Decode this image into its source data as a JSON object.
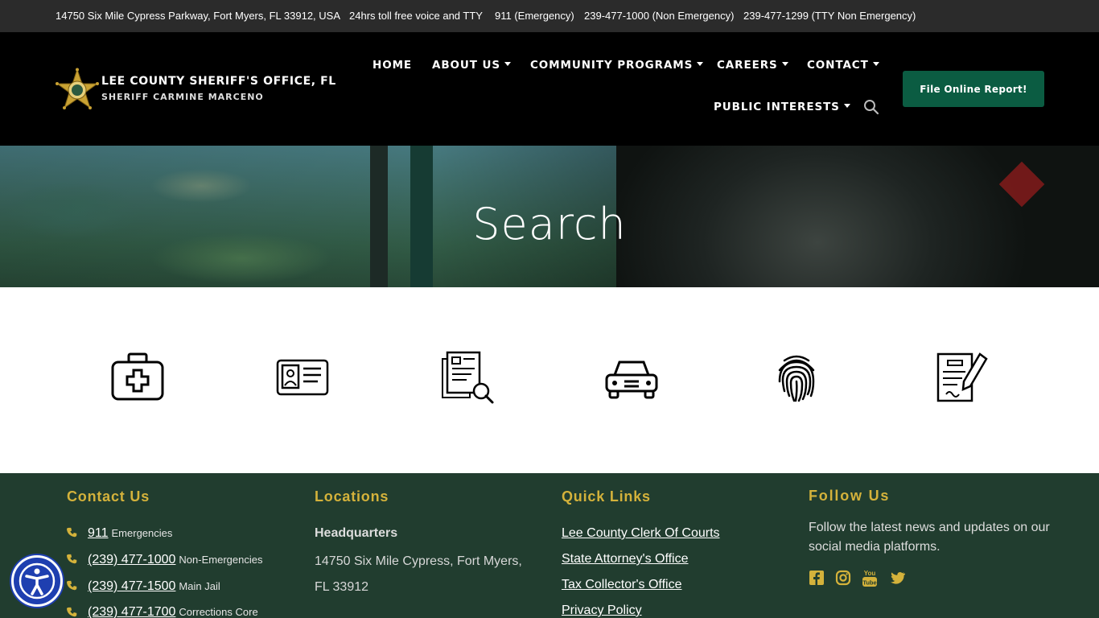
{
  "topbar": {
    "address": "14750 Six Mile Cypress Parkway, Fort Myers, FL 33912, USA",
    "tty": "24hrs toll free voice and TTY",
    "emergency": "911 (Emergency)",
    "non_emergency": "239-477-1000 (Non Emergency)",
    "tty_non_emergency": "239-477-1299 (TTY Non Emergency)"
  },
  "header": {
    "title": "LEE COUNTY SHERIFF'S OFFICE, FL",
    "subtitle": "SHERIFF CARMINE MARCENO",
    "nav": {
      "home": "HOME",
      "about": "ABOUT US",
      "community": "COMMUNITY PROGRAMS",
      "careers": "CAREERS",
      "contact": "CONTACT",
      "public": "PUBLIC INTERESTS"
    },
    "report_button": "File Online Report!"
  },
  "hero": {
    "title": "Search"
  },
  "services": [
    {
      "icon": "medical-kit-icon"
    },
    {
      "icon": "id-card-icon"
    },
    {
      "icon": "document-search-icon"
    },
    {
      "icon": "car-icon"
    },
    {
      "icon": "fingerprint-icon"
    },
    {
      "icon": "report-form-icon"
    }
  ],
  "footer": {
    "contact": {
      "heading": "Contact Us",
      "items": [
        {
          "number": "911",
          "note": "Emergencies"
        },
        {
          "number": "(239) 477-1000",
          "note": "Non-Emergencies"
        },
        {
          "number": "(239) 477-1500",
          "note": "Main Jail"
        },
        {
          "number": "(239) 477-1700",
          "note": "Corrections Core"
        }
      ]
    },
    "locations": {
      "heading": "Locations",
      "hq": "Headquarters",
      "address": "14750 Six Mile Cypress, Fort Myers, FL 33912"
    },
    "quick_links": {
      "heading": "Quick Links",
      "items": [
        "Lee County Clerk Of Courts",
        "State Attorney's Office",
        "Tax Collector's Office",
        "Privacy Policy"
      ]
    },
    "follow": {
      "heading": "Follow Us",
      "text": "Follow the latest news and updates on our social media platforms.",
      "networks": [
        "facebook-icon",
        "instagram-icon",
        "youtube-icon",
        "twitter-icon"
      ]
    }
  },
  "colors": {
    "topbar": "#2b2b2b",
    "header": "#000000",
    "report_button": "#0b5c42",
    "footer": "#213d2f",
    "footer_heading": "#d4b23b",
    "accessibility": "#1e3fb0"
  }
}
